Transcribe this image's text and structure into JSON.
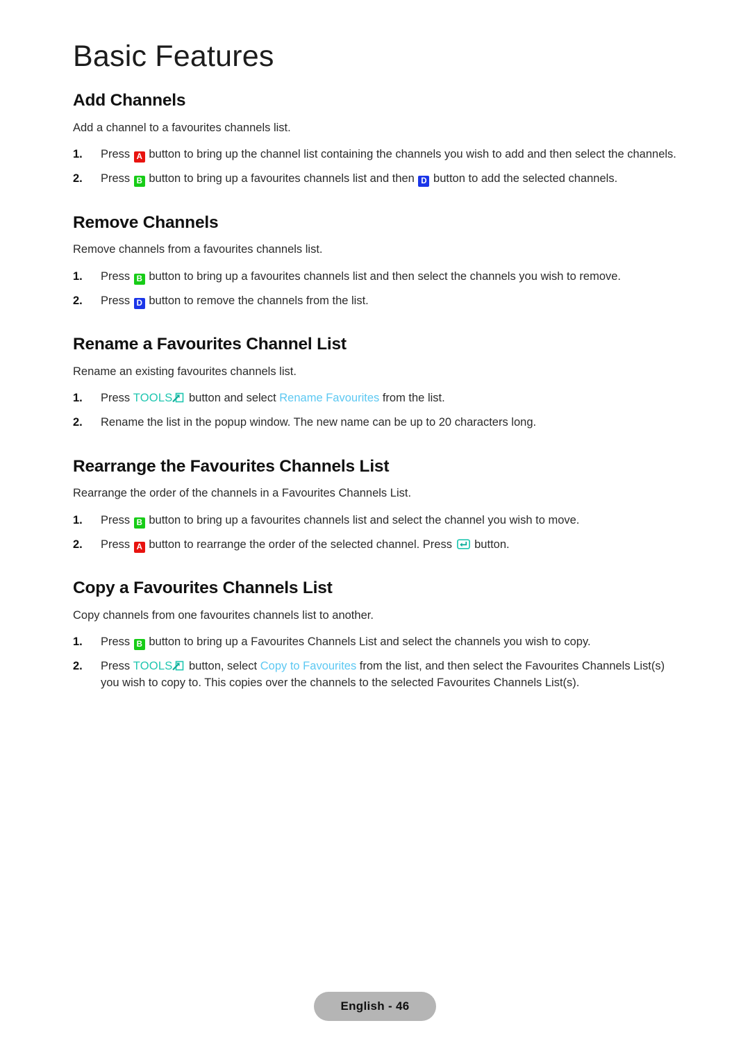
{
  "page": {
    "chapter_title": "Basic Features",
    "footer_label": "English - 46"
  },
  "colors": {
    "key_red": "#e8130f",
    "key_green": "#17cc17",
    "key_blue": "#1b36e8",
    "tools_teal": "#1fc6b0",
    "menu_link_blue": "#5cc8f2",
    "footer_pill_bg": "#b5b5b5",
    "body_text": "#2b2b2b",
    "heading_text": "#111111"
  },
  "icons": {
    "key_a": "A",
    "key_b": "B",
    "key_d": "D",
    "tools_label": "TOOLS",
    "tools_icon_name": "tools-arrow-icon",
    "enter_icon_name": "enter-key-icon"
  },
  "sections": [
    {
      "heading": "Add Channels",
      "intro": "Add a channel to a favourites channels list.",
      "steps": [
        {
          "num": "1.",
          "parts": [
            {
              "t": "text",
              "v": "Press "
            },
            {
              "t": "key",
              "v": "A",
              "color": "red"
            },
            {
              "t": "text",
              "v": " button to bring up the channel list containing the channels you wish to add and then select the channels."
            }
          ]
        },
        {
          "num": "2.",
          "parts": [
            {
              "t": "text",
              "v": "Press "
            },
            {
              "t": "key",
              "v": "B",
              "color": "green"
            },
            {
              "t": "text",
              "v": " button to bring up a favourites channels list and then "
            },
            {
              "t": "key",
              "v": "D",
              "color": "blue"
            },
            {
              "t": "text",
              "v": " button to add the selected channels."
            }
          ]
        }
      ]
    },
    {
      "heading": "Remove Channels",
      "intro": "Remove channels from a favourites channels list.",
      "steps": [
        {
          "num": "1.",
          "parts": [
            {
              "t": "text",
              "v": "Press "
            },
            {
              "t": "key",
              "v": "B",
              "color": "green"
            },
            {
              "t": "text",
              "v": " button to bring up a favourites channels list and then select the channels you wish to remove."
            }
          ]
        },
        {
          "num": "2.",
          "parts": [
            {
              "t": "text",
              "v": "Press "
            },
            {
              "t": "key",
              "v": "D",
              "color": "blue"
            },
            {
              "t": "text",
              "v": " button to remove the channels from the list."
            }
          ]
        }
      ]
    },
    {
      "heading": "Rename a Favourites Channel List",
      "intro": "Rename an existing favourites channels list.",
      "steps": [
        {
          "num": "1.",
          "parts": [
            {
              "t": "text",
              "v": "Press "
            },
            {
              "t": "tools",
              "v": "TOOLS"
            },
            {
              "t": "text",
              "v": " button and select "
            },
            {
              "t": "link",
              "v": "Rename Favourites"
            },
            {
              "t": "text",
              "v": " from the list."
            }
          ]
        },
        {
          "num": "2.",
          "parts": [
            {
              "t": "text",
              "v": "Rename the list in the popup window. The new name can be up to 20 characters long."
            }
          ]
        }
      ]
    },
    {
      "heading": "Rearrange the Favourites Channels List",
      "intro": "Rearrange the order of the channels in a Favourites Channels List.",
      "steps": [
        {
          "num": "1.",
          "parts": [
            {
              "t": "text",
              "v": "Press "
            },
            {
              "t": "key",
              "v": "B",
              "color": "green"
            },
            {
              "t": "text",
              "v": " button to bring up a favourites channels list and select the channel you wish to move."
            }
          ]
        },
        {
          "num": "2.",
          "parts": [
            {
              "t": "text",
              "v": "Press "
            },
            {
              "t": "key",
              "v": "A",
              "color": "red"
            },
            {
              "t": "text",
              "v": " button to rearrange the order of the selected channel. Press "
            },
            {
              "t": "enter",
              "v": ""
            },
            {
              "t": "text",
              "v": " button."
            }
          ]
        }
      ]
    },
    {
      "heading": "Copy a Favourites Channels List",
      "intro": "Copy channels from one favourites channels list to another.",
      "steps": [
        {
          "num": "1.",
          "parts": [
            {
              "t": "text",
              "v": "Press "
            },
            {
              "t": "key",
              "v": "B",
              "color": "green"
            },
            {
              "t": "text",
              "v": " button to bring up a Favourites Channels List and select the channels you wish to copy."
            }
          ]
        },
        {
          "num": "2.",
          "parts": [
            {
              "t": "text",
              "v": "Press "
            },
            {
              "t": "tools",
              "v": "TOOLS"
            },
            {
              "t": "text",
              "v": " button, select "
            },
            {
              "t": "link",
              "v": "Copy to Favourites"
            },
            {
              "t": "text",
              "v": " from the list, and then select the Favourites Channels List(s) you wish to copy to. This copies over the channels to the selected Favourites Channels List(s)."
            }
          ]
        }
      ]
    }
  ]
}
